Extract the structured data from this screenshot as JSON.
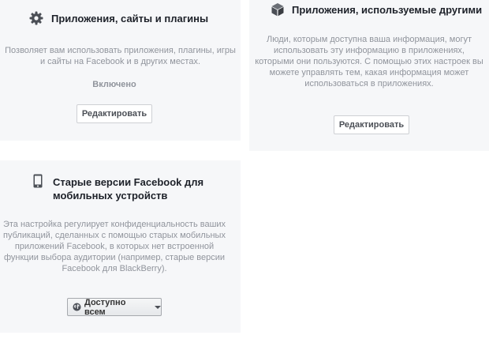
{
  "apps_card": {
    "icon": "gear-icon",
    "title": "Приложения, сайты и плагины",
    "description_lines": [
      "Позволяет вам использовать приложения, плагины, игры",
      "и сайты на Facebook и в других местах."
    ],
    "status": "Включено",
    "edit_label": "Редактировать"
  },
  "others_card": {
    "icon": "cube-icon",
    "title": "Приложения, используемые другими",
    "description_lines": [
      "Люди, которым доступна ваша информация, могут",
      "использовать эту информацию в приложениях,",
      "которыми они пользуются. С помощью этих настроек вы",
      "можете управлять тем, какая информация может",
      "использоваться в приложениях."
    ],
    "edit_label": "Редактировать"
  },
  "mobile_card": {
    "icon": "mobile-phone-icon",
    "title_lines": [
      "Старые версии Facebook для",
      "мобильных устройств"
    ],
    "description_lines": [
      "Эта настройка регулирует конфиденциальность ваших",
      "публикаций, сделанных с помощью старых мобильных",
      "приложений Facebook, в которых нет встроенной",
      "функции выбора аудитории (например, старые версии",
      "Facebook для BlackBerry)."
    ],
    "audience": {
      "icon": "globe-icon",
      "label": "Доступно всем",
      "caret_icon": "caret-down-icon"
    }
  },
  "colors": {
    "card_bg": "#f6f7f9",
    "title": "#1d2129",
    "muted_text": "#90949c",
    "button_border": "#ced0d4"
  }
}
